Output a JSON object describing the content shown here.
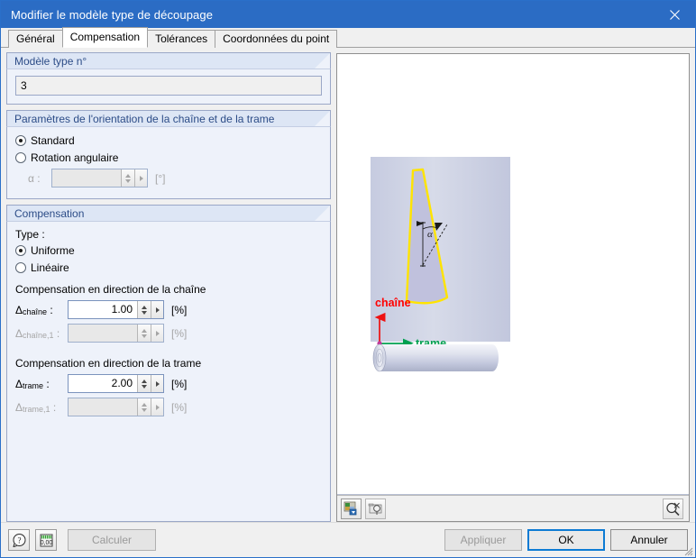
{
  "window": {
    "title": "Modifier le modèle type de découpage",
    "close_icon": "close-icon"
  },
  "tabs": [
    {
      "label": "Général",
      "active": false
    },
    {
      "label": "Compensation",
      "active": true
    },
    {
      "label": "Tolérances",
      "active": false
    },
    {
      "label": "Coordonnées du point",
      "active": false
    }
  ],
  "groups": {
    "model": {
      "title": "Modèle type n°",
      "value": "3"
    },
    "orientation": {
      "title": "Paramètres de l'orientation de la chaîne et de la trame",
      "options": [
        {
          "label": "Standard",
          "selected": true
        },
        {
          "label": "Rotation angulaire",
          "selected": false
        }
      ],
      "alpha_label": "α :",
      "alpha_value": "",
      "alpha_unit": "[°]"
    },
    "compensation": {
      "title": "Compensation",
      "type_label": "Type :",
      "type_options": [
        {
          "label": "Uniforme",
          "selected": true
        },
        {
          "label": "Linéaire",
          "selected": false
        }
      ],
      "warp_section_label": "Compensation en direction de la chaîne",
      "warp_fields": [
        {
          "label_main": "Δ",
          "label_sub": "chaîne",
          "label_suffix": " :",
          "value": "1.00",
          "unit": "[%]",
          "disabled": false
        },
        {
          "label_main": "Δ",
          "label_sub": "chaîne,1",
          "label_suffix": " :",
          "value": "",
          "unit": "[%]",
          "disabled": true
        }
      ],
      "weft_section_label": "Compensation en direction de la trame",
      "weft_fields": [
        {
          "label_main": "Δ",
          "label_sub": "trame",
          "label_suffix": " :",
          "value": "2.00",
          "unit": "[%]",
          "disabled": false
        },
        {
          "label_main": "Δ",
          "label_sub": "trame,1",
          "label_suffix": " :",
          "value": "",
          "unit": "[%]",
          "disabled": true
        }
      ]
    }
  },
  "preview": {
    "labels": {
      "warp": "chaîne",
      "weft": "trame",
      "angle": "α"
    },
    "colors": {
      "warp_label": "#ff0000",
      "weft_label": "#00a050",
      "cut_outline": "#ffe600",
      "cut_fill": "#bfc0dc",
      "fabric": "#ccd0e2"
    },
    "toolbar": {
      "buttons": [
        {
          "name": "image-export-icon"
        },
        {
          "name": "print-preview-icon"
        }
      ],
      "right_button": {
        "name": "zoom-reset-icon"
      }
    }
  },
  "footer": {
    "help_icon": "help-icon",
    "units_icon": "units-icon",
    "calculer": "Calculer",
    "appliquer": "Appliquer",
    "ok": "OK",
    "annuler": "Annuler"
  }
}
